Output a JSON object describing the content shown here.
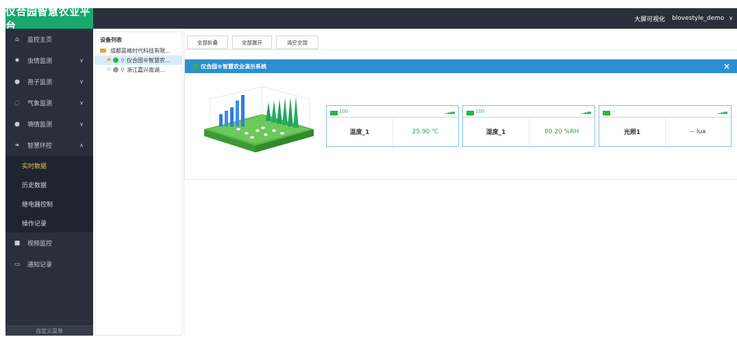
{
  "header": {
    "title": "仪合园智慧农业平台",
    "right_link": "大屏可视化",
    "user": "blovestyle_demo",
    "user_chevron": "∨"
  },
  "sidebar": {
    "items": [
      {
        "label": "监控主页",
        "icon": "home-icon",
        "chevron": ""
      },
      {
        "label": "虫情监测",
        "icon": "bug-icon",
        "chevron": "∨"
      },
      {
        "label": "孢子监测",
        "icon": "spore-icon",
        "chevron": "∨"
      },
      {
        "label": "气象监测",
        "icon": "weather-icon",
        "chevron": "∨"
      },
      {
        "label": "墒情监测",
        "icon": "soil-icon",
        "chevron": "∨"
      },
      {
        "label": "智慧环控",
        "icon": "leaf-icon",
        "chevron": "∧"
      }
    ],
    "sub_items": [
      {
        "label": "实时数据",
        "active": true
      },
      {
        "label": "历史数据",
        "active": false
      },
      {
        "label": "继电器控制",
        "active": false
      },
      {
        "label": "操作记录",
        "active": false
      }
    ],
    "items_after": [
      {
        "label": "视频监控",
        "icon": "video-icon"
      },
      {
        "label": "通知记录",
        "icon": "notice-icon"
      }
    ],
    "bottom_label": "自定义菜单"
  },
  "device_panel": {
    "title": "设备列表",
    "tree": [
      {
        "label": "成都蓝格时代科技有限..."
      },
      {
        "label": "仪合园®智慧农...",
        "starred": true,
        "status_color": "#2eb84b"
      },
      {
        "label": "浙江嘉兴南湖...",
        "starred": false,
        "status_color": "#9a9a9a"
      }
    ]
  },
  "toolbar": {
    "collapse_all": "全部折叠",
    "expand_all": "全部展开",
    "clear_all": "清空全部"
  },
  "card": {
    "title": "仪合园®智慧农业演示系统",
    "close": "×"
  },
  "sensors": [
    {
      "battery": "100",
      "name": "温度_1",
      "value": "25.90 ℃",
      "value_color": "#2e9e57"
    },
    {
      "battery": "100",
      "name": "湿度_1",
      "value": "80.20 %RH",
      "value_color": "#2e9e57"
    },
    {
      "battery": "--",
      "name": "光照1",
      "value": "-- lux",
      "value_color": "#333333"
    }
  ],
  "colors": {
    "topbar": "#2a303b",
    "logo": "#19a86d",
    "card_header": "#2e8ecf",
    "sensor_border": "#7ec0e8"
  }
}
